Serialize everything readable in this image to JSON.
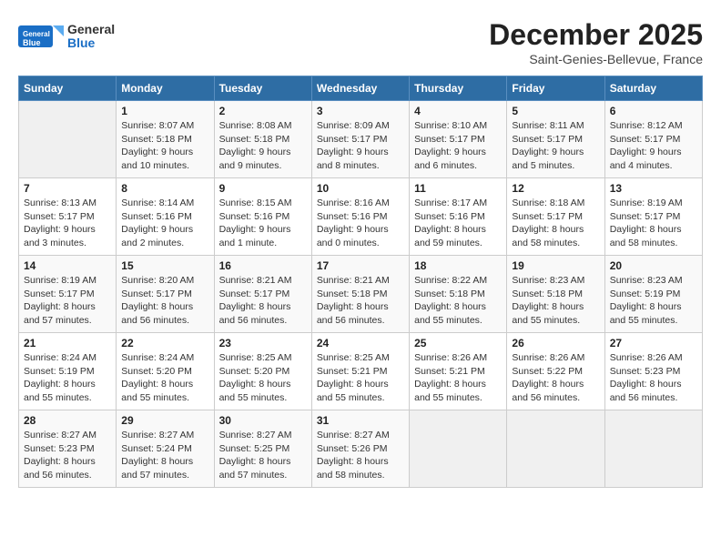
{
  "header": {
    "logo_general": "General",
    "logo_blue": "Blue",
    "month": "December 2025",
    "location": "Saint-Genies-Bellevue, France"
  },
  "days_of_week": [
    "Sunday",
    "Monday",
    "Tuesday",
    "Wednesday",
    "Thursday",
    "Friday",
    "Saturday"
  ],
  "weeks": [
    [
      {
        "day": "",
        "sunrise": "",
        "sunset": "",
        "daylight": ""
      },
      {
        "day": "1",
        "sunrise": "Sunrise: 8:07 AM",
        "sunset": "Sunset: 5:18 PM",
        "daylight": "Daylight: 9 hours and 10 minutes."
      },
      {
        "day": "2",
        "sunrise": "Sunrise: 8:08 AM",
        "sunset": "Sunset: 5:18 PM",
        "daylight": "Daylight: 9 hours and 9 minutes."
      },
      {
        "day": "3",
        "sunrise": "Sunrise: 8:09 AM",
        "sunset": "Sunset: 5:17 PM",
        "daylight": "Daylight: 9 hours and 8 minutes."
      },
      {
        "day": "4",
        "sunrise": "Sunrise: 8:10 AM",
        "sunset": "Sunset: 5:17 PM",
        "daylight": "Daylight: 9 hours and 6 minutes."
      },
      {
        "day": "5",
        "sunrise": "Sunrise: 8:11 AM",
        "sunset": "Sunset: 5:17 PM",
        "daylight": "Daylight: 9 hours and 5 minutes."
      },
      {
        "day": "6",
        "sunrise": "Sunrise: 8:12 AM",
        "sunset": "Sunset: 5:17 PM",
        "daylight": "Daylight: 9 hours and 4 minutes."
      }
    ],
    [
      {
        "day": "7",
        "sunrise": "Sunrise: 8:13 AM",
        "sunset": "Sunset: 5:17 PM",
        "daylight": "Daylight: 9 hours and 3 minutes."
      },
      {
        "day": "8",
        "sunrise": "Sunrise: 8:14 AM",
        "sunset": "Sunset: 5:16 PM",
        "daylight": "Daylight: 9 hours and 2 minutes."
      },
      {
        "day": "9",
        "sunrise": "Sunrise: 8:15 AM",
        "sunset": "Sunset: 5:16 PM",
        "daylight": "Daylight: 9 hours and 1 minute."
      },
      {
        "day": "10",
        "sunrise": "Sunrise: 8:16 AM",
        "sunset": "Sunset: 5:16 PM",
        "daylight": "Daylight: 9 hours and 0 minutes."
      },
      {
        "day": "11",
        "sunrise": "Sunrise: 8:17 AM",
        "sunset": "Sunset: 5:16 PM",
        "daylight": "Daylight: 8 hours and 59 minutes."
      },
      {
        "day": "12",
        "sunrise": "Sunrise: 8:18 AM",
        "sunset": "Sunset: 5:17 PM",
        "daylight": "Daylight: 8 hours and 58 minutes."
      },
      {
        "day": "13",
        "sunrise": "Sunrise: 8:19 AM",
        "sunset": "Sunset: 5:17 PM",
        "daylight": "Daylight: 8 hours and 58 minutes."
      }
    ],
    [
      {
        "day": "14",
        "sunrise": "Sunrise: 8:19 AM",
        "sunset": "Sunset: 5:17 PM",
        "daylight": "Daylight: 8 hours and 57 minutes."
      },
      {
        "day": "15",
        "sunrise": "Sunrise: 8:20 AM",
        "sunset": "Sunset: 5:17 PM",
        "daylight": "Daylight: 8 hours and 56 minutes."
      },
      {
        "day": "16",
        "sunrise": "Sunrise: 8:21 AM",
        "sunset": "Sunset: 5:17 PM",
        "daylight": "Daylight: 8 hours and 56 minutes."
      },
      {
        "day": "17",
        "sunrise": "Sunrise: 8:21 AM",
        "sunset": "Sunset: 5:18 PM",
        "daylight": "Daylight: 8 hours and 56 minutes."
      },
      {
        "day": "18",
        "sunrise": "Sunrise: 8:22 AM",
        "sunset": "Sunset: 5:18 PM",
        "daylight": "Daylight: 8 hours and 55 minutes."
      },
      {
        "day": "19",
        "sunrise": "Sunrise: 8:23 AM",
        "sunset": "Sunset: 5:18 PM",
        "daylight": "Daylight: 8 hours and 55 minutes."
      },
      {
        "day": "20",
        "sunrise": "Sunrise: 8:23 AM",
        "sunset": "Sunset: 5:19 PM",
        "daylight": "Daylight: 8 hours and 55 minutes."
      }
    ],
    [
      {
        "day": "21",
        "sunrise": "Sunrise: 8:24 AM",
        "sunset": "Sunset: 5:19 PM",
        "daylight": "Daylight: 8 hours and 55 minutes."
      },
      {
        "day": "22",
        "sunrise": "Sunrise: 8:24 AM",
        "sunset": "Sunset: 5:20 PM",
        "daylight": "Daylight: 8 hours and 55 minutes."
      },
      {
        "day": "23",
        "sunrise": "Sunrise: 8:25 AM",
        "sunset": "Sunset: 5:20 PM",
        "daylight": "Daylight: 8 hours and 55 minutes."
      },
      {
        "day": "24",
        "sunrise": "Sunrise: 8:25 AM",
        "sunset": "Sunset: 5:21 PM",
        "daylight": "Daylight: 8 hours and 55 minutes."
      },
      {
        "day": "25",
        "sunrise": "Sunrise: 8:26 AM",
        "sunset": "Sunset: 5:21 PM",
        "daylight": "Daylight: 8 hours and 55 minutes."
      },
      {
        "day": "26",
        "sunrise": "Sunrise: 8:26 AM",
        "sunset": "Sunset: 5:22 PM",
        "daylight": "Daylight: 8 hours and 56 minutes."
      },
      {
        "day": "27",
        "sunrise": "Sunrise: 8:26 AM",
        "sunset": "Sunset: 5:23 PM",
        "daylight": "Daylight: 8 hours and 56 minutes."
      }
    ],
    [
      {
        "day": "28",
        "sunrise": "Sunrise: 8:27 AM",
        "sunset": "Sunset: 5:23 PM",
        "daylight": "Daylight: 8 hours and 56 minutes."
      },
      {
        "day": "29",
        "sunrise": "Sunrise: 8:27 AM",
        "sunset": "Sunset: 5:24 PM",
        "daylight": "Daylight: 8 hours and 57 minutes."
      },
      {
        "day": "30",
        "sunrise": "Sunrise: 8:27 AM",
        "sunset": "Sunset: 5:25 PM",
        "daylight": "Daylight: 8 hours and 57 minutes."
      },
      {
        "day": "31",
        "sunrise": "Sunrise: 8:27 AM",
        "sunset": "Sunset: 5:26 PM",
        "daylight": "Daylight: 8 hours and 58 minutes."
      },
      {
        "day": "",
        "sunrise": "",
        "sunset": "",
        "daylight": ""
      },
      {
        "day": "",
        "sunrise": "",
        "sunset": "",
        "daylight": ""
      },
      {
        "day": "",
        "sunrise": "",
        "sunset": "",
        "daylight": ""
      }
    ]
  ]
}
